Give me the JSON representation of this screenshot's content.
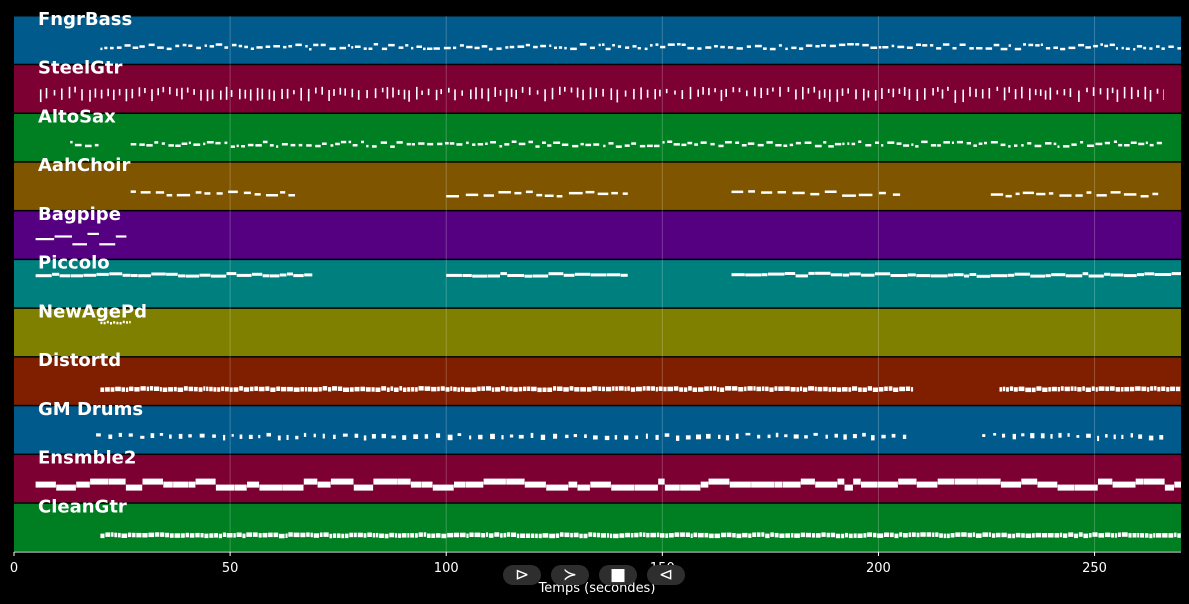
{
  "chart_data": {
    "type": "piano-roll",
    "xlabel": "Temps (secondes)",
    "xlim": [
      0,
      270
    ],
    "xticks": [
      0,
      50,
      100,
      150,
      200,
      250
    ],
    "tracks": [
      {
        "name": "FngrBass",
        "color": "#005a8c",
        "segments": [
          [
            20,
            270
          ]
        ],
        "style": "dots"
      },
      {
        "name": "SteelGtr",
        "color": "#7d0033",
        "segments": [
          [
            6,
            266
          ]
        ],
        "style": "vertical"
      },
      {
        "name": "AltoSax",
        "color": "#007f22",
        "segments": [
          [
            13,
            20
          ],
          [
            27,
            266
          ]
        ],
        "style": "dots"
      },
      {
        "name": "AahChoir",
        "color": "#7f5500",
        "segments": [
          [
            27,
            65
          ],
          [
            100,
            142
          ],
          [
            166,
            205
          ],
          [
            226,
            266
          ]
        ],
        "style": "dashes"
      },
      {
        "name": "Bagpipe",
        "color": "#550080",
        "segments": [
          [
            5,
            26
          ]
        ],
        "style": "block"
      },
      {
        "name": "Piccolo",
        "color": "#007f7f",
        "segments": [
          [
            5,
            69
          ],
          [
            100,
            142
          ],
          [
            166,
            270
          ]
        ],
        "style": "line"
      },
      {
        "name": "NewAgePd",
        "color": "#7f7f00",
        "segments": [
          [
            20,
            27
          ]
        ],
        "style": "small"
      },
      {
        "name": "Distortd",
        "color": "#7f1f00",
        "segments": [
          [
            20,
            208
          ],
          [
            228,
            270
          ]
        ],
        "style": "dense"
      },
      {
        "name": "GM Drums",
        "color": "#005a8c",
        "segments": [
          [
            19,
            208
          ],
          [
            224,
            266
          ]
        ],
        "style": "sparse"
      },
      {
        "name": "Ensmble2",
        "color": "#7d0033",
        "segments": [
          [
            5,
            270
          ]
        ],
        "style": "thick"
      },
      {
        "name": "CleanGtr",
        "color": "#007f22",
        "segments": [
          [
            20,
            270
          ]
        ],
        "style": "dense"
      }
    ]
  },
  "controls": {
    "play_label": "⊳",
    "forward_label": "≻",
    "stop_label": "■",
    "back_label": "⊲"
  }
}
